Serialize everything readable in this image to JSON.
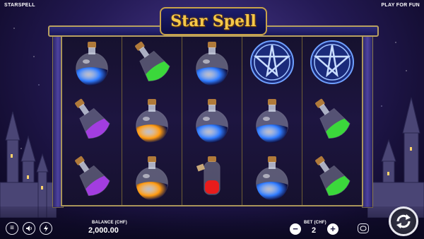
{
  "game": {
    "title": "STARSPELL",
    "mode": "PLAY FOR FUN",
    "logo": "Star Spell"
  },
  "reels": [
    [
      "blue-potion-icon",
      "purple-potion-icon",
      "purple-potion-icon"
    ],
    [
      "green-potion-icon",
      "orange-potion-icon",
      "orange-potion-icon"
    ],
    [
      "blue-potion-icon",
      "blue-potion-icon",
      "red-potion-icon"
    ],
    [
      "pentagram-icon",
      "blue-potion-icon",
      "blue-potion-icon"
    ],
    [
      "pentagram-icon",
      "green-potion-icon",
      "green-potion-icon"
    ]
  ],
  "balance": {
    "label": "BALANCE (CHF)",
    "value": "2,000.00"
  },
  "bet": {
    "label": "BET (CHF)",
    "value": "2"
  },
  "controls": {
    "menu": "hamburger-menu-icon",
    "sound": "speaker-icon",
    "turbo": "lightning-icon",
    "decrease": "−",
    "increase": "+",
    "autoplay": "autoplay-icon",
    "spin": "spin-arrows-icon"
  },
  "colors": {
    "blue": "#2f7bff",
    "purple": "#a23de0",
    "green": "#3bd83b",
    "orange": "#ff9a10",
    "red": "#e81c1c",
    "gold": "#f5c84a"
  }
}
